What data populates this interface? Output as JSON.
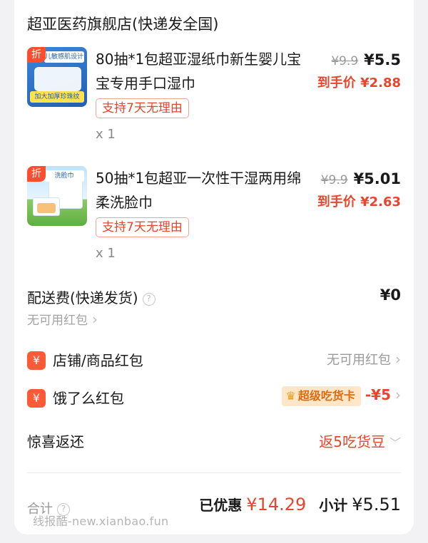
{
  "store": {
    "name": "超亚医药旗舰店(快递发全国)"
  },
  "items": [
    {
      "badge": "折",
      "thumb_banner": "儿敏感肌设计",
      "thumb_tag": "加大加厚珍珠纹",
      "title": "80抽*1包超亚湿纸巾新生婴儿宝宝专用手口湿巾",
      "original_price": "¥9.9",
      "price": "¥5.5",
      "arrive_price": "到手价 ¥2.88",
      "promise": "支持7天无理由",
      "quantity": "x 1"
    },
    {
      "badge": "折",
      "thumb_banner": "洗脸巾",
      "thumb_tag": "",
      "title": "50抽*1包超亚一次性干湿两用绵柔洗脸巾",
      "original_price": "¥9.9",
      "price": "¥5.01",
      "arrive_price": "到手价 ¥2.63",
      "promise": "支持7天无理由",
      "quantity": "x 1"
    }
  ],
  "delivery": {
    "label": "配送费(快递发货)",
    "help_icon": "?",
    "sub": "无可用红包",
    "value": "¥0"
  },
  "shop_coupon": {
    "icon": "¥",
    "label": "店铺/商品红包",
    "value": "无可用红包"
  },
  "eleme_coupon": {
    "icon": "¥",
    "label": "饿了么红包",
    "badge": "超级吃货卡",
    "value": "-¥5"
  },
  "surprise": {
    "label": "惊喜返还",
    "value": "返5吃货豆"
  },
  "summary": {
    "total_label": "合计",
    "saved_label": "已优惠",
    "saved_value": "¥14.29",
    "subtotal_label": "小计",
    "subtotal_value": "¥5.51"
  },
  "watermark": "线报酷-new.xianbao.fun",
  "colors": {
    "accent_red": "#e8452c",
    "badge_orange": "#ff5a36",
    "super_badge_bg": "#fde7c8"
  }
}
